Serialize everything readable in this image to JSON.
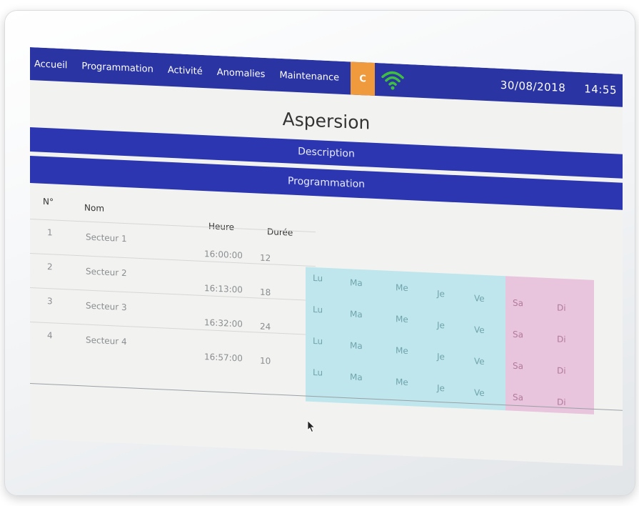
{
  "nav": {
    "items": [
      "Accueil",
      "Programmation",
      "Activité",
      "Anomalies",
      "Maintenance"
    ],
    "status_badge": "C",
    "date": "30/08/2018",
    "time": "14:55",
    "accent_color": "#2a34a3",
    "badge_color": "#f09a3e",
    "wifi_color": "#3fbf3f"
  },
  "page": {
    "title": "Aspersion"
  },
  "sections": {
    "description": "Description",
    "programmation": "Programmation"
  },
  "table": {
    "headers": {
      "num": "N°",
      "name": "Nom",
      "time": "Heure",
      "duration": "Durée"
    },
    "rows": [
      {
        "num": "1",
        "name": "Secteur 1",
        "time": "16:00:00",
        "duration": "12"
      },
      {
        "num": "2",
        "name": "Secteur 2",
        "time": "16:13:00",
        "duration": "18"
      },
      {
        "num": "3",
        "name": "Secteur 3",
        "time": "16:32:00",
        "duration": "24"
      },
      {
        "num": "4",
        "name": "Secteur 4",
        "time": "16:57:00",
        "duration": "10"
      }
    ],
    "weekdays": [
      "Lu",
      "Ma",
      "Me",
      "Je",
      "Ve"
    ],
    "weekend": [
      "Sa",
      "Di"
    ]
  }
}
